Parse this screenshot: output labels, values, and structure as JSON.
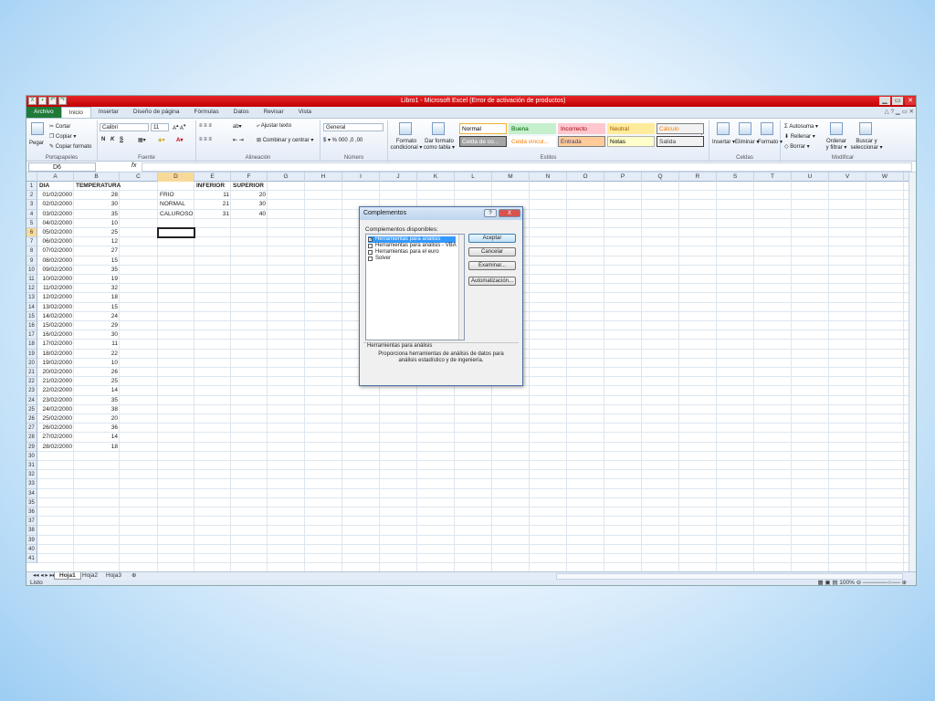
{
  "titlebar": {
    "title": "Libro1 - Microsoft Excel (Error de activación de productos)",
    "min": "▁",
    "max": "▭",
    "close": "✕"
  },
  "tabs": {
    "file": "Archivo",
    "items": [
      "Inicio",
      "Insertar",
      "Diseño de página",
      "Fórmulas",
      "Datos",
      "Revisar",
      "Vista"
    ],
    "right": "△ ? ▁ ▭ ✕"
  },
  "ribbon": {
    "portapapeles": {
      "label": "Portapapeles",
      "pegar": "Pegar",
      "cortar": "Cortar",
      "copiar": "Copiar ▾",
      "copiar_formato": "Copiar formato"
    },
    "fuente": {
      "label": "Fuente",
      "font": "Calibri",
      "size": "11",
      "bold": "N",
      "italic": "K",
      "underline": "S"
    },
    "alineacion": {
      "label": "Alineación",
      "ajustar": "Ajustar texto",
      "combinar": "Combinar y centrar ▾"
    },
    "numero": {
      "label": "Número",
      "format": "General",
      "symbols": "$ ▾ % 000 ,0 ,00"
    },
    "estilos": {
      "label": "Estilos",
      "formato_condicional": "Formato condicional ▾",
      "dar_formato": "Dar formato como tabla ▾",
      "cells": [
        {
          "text": "Normal",
          "bg": "#ffffff",
          "fg": "#000000",
          "border": "#f0b030"
        },
        {
          "text": "Buena",
          "bg": "#c6efce",
          "fg": "#006100",
          "border": "#c6efce"
        },
        {
          "text": "Incorrecto",
          "bg": "#ffc7ce",
          "fg": "#9c0006",
          "border": "#ffc7ce"
        },
        {
          "text": "Neutral",
          "bg": "#ffeb9c",
          "fg": "#9c5700",
          "border": "#ffeb9c"
        },
        {
          "text": "Cálculo",
          "bg": "#f2f2f2",
          "fg": "#fa7d00",
          "border": "#7f7f7f"
        },
        {
          "text": "Celda de co...",
          "bg": "#a5a5a5",
          "fg": "#ffffff",
          "border": "#3f3f3f"
        },
        {
          "text": "Celda vincul...",
          "bg": "#ffffff",
          "fg": "#fa7d00",
          "border": "#ffffff"
        },
        {
          "text": "Entrada",
          "bg": "#ffcc99",
          "fg": "#3f3f76",
          "border": "#7f7f7f"
        },
        {
          "text": "Notas",
          "bg": "#ffffcc",
          "fg": "#000000",
          "border": "#b2b2b2"
        },
        {
          "text": "Salida",
          "bg": "#f2f2f2",
          "fg": "#3f3f3f",
          "border": "#3f3f3f"
        }
      ]
    },
    "celdas": {
      "label": "Celdas",
      "insertar": "Insertar ▾",
      "eliminar": "Eliminar ▾",
      "formato": "Formato ▾"
    },
    "modificar": {
      "label": "Modificar",
      "autosuma": "Σ Autosuma ▾",
      "rellenar": "Rellenar ▾",
      "borrar": "Borrar ▾",
      "ordenar": "Ordenar y filtrar ▾",
      "buscar": "Buscar y seleccionar ▾"
    }
  },
  "formula_bar": {
    "name_box": "D6",
    "fx": "fx",
    "value": ""
  },
  "sheet": {
    "columns": [
      "A",
      "B",
      "C",
      "D",
      "E",
      "F",
      "G",
      "H",
      "I",
      "J",
      "K",
      "L",
      "M",
      "N",
      "O",
      "P",
      "Q",
      "R",
      "S",
      "T",
      "U",
      "V",
      "W"
    ],
    "selected_column": "D",
    "selected_row": 6,
    "row_count": 41,
    "colA": [
      "DIA",
      "01/02/2000",
      "02/02/2000",
      "03/02/2000",
      "04/02/2000",
      "05/02/2000",
      "06/02/2000",
      "07/02/2000",
      "08/02/2000",
      "09/02/2000",
      "10/02/2000",
      "11/02/2000",
      "12/02/2000",
      "13/02/2000",
      "14/02/2000",
      "15/02/2000",
      "16/02/2000",
      "17/02/2000",
      "18/02/2000",
      "19/02/2000",
      "20/02/2000",
      "21/02/2000",
      "22/02/2000",
      "23/02/2000",
      "24/02/2000",
      "25/02/2000",
      "26/02/2000",
      "27/02/2000",
      "28/02/2000"
    ],
    "colB": [
      "TEMPERATURA",
      "28",
      "30",
      "35",
      "10",
      "25",
      "12",
      "27",
      "15",
      "35",
      "19",
      "32",
      "18",
      "15",
      "24",
      "29",
      "30",
      "11",
      "22",
      "10",
      "26",
      "25",
      "14",
      "35",
      "38",
      "20",
      "36",
      "14",
      "18"
    ],
    "table": {
      "headers": [
        "INFERIOR",
        "SUPERIOR"
      ],
      "rows": [
        {
          "label": "FRIO",
          "inf": "11",
          "sup": "20"
        },
        {
          "label": "NORMAL",
          "inf": "21",
          "sup": "30"
        },
        {
          "label": "CALUROSO",
          "inf": "31",
          "sup": "40"
        }
      ]
    },
    "sheet_tabs": [
      "Hoja1",
      "Hoja2",
      "Hoja3"
    ],
    "active_sheet": "Hoja1"
  },
  "status": {
    "text": "Listo",
    "zoom": "100%"
  },
  "dialog": {
    "title": "Complementos",
    "help": "?",
    "close": "X",
    "list_label": "Complementos disponibles:",
    "items": [
      {
        "label": "Herramientas para análisis",
        "checked": true,
        "selected": true
      },
      {
        "label": "Herramientas para análisis - VBA",
        "checked": false,
        "selected": false
      },
      {
        "label": "Herramientas para el euro",
        "checked": false,
        "selected": false
      },
      {
        "label": "Solver",
        "checked": false,
        "selected": false
      }
    ],
    "buttons": {
      "aceptar": "Aceptar",
      "cancelar": "Cancelar",
      "examinar": "Examinar...",
      "automatizacion": "Automatización..."
    },
    "selected_name": "Herramientas para análisis",
    "description": "Proporciona herramientas de análisis de datos para análisis estadístico y de ingeniería."
  }
}
